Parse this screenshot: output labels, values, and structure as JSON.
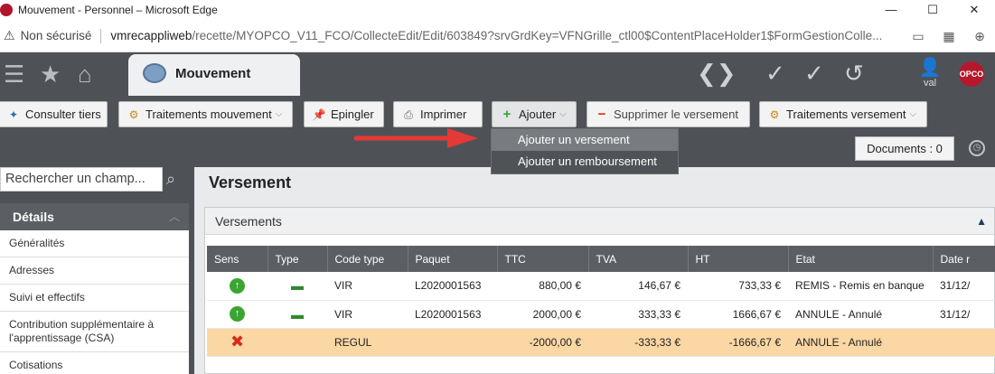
{
  "window": {
    "title": "Mouvement - Personnel – Microsoft Edge",
    "controls": {
      "minimize": "—",
      "maximize": "☐",
      "close": "✕"
    }
  },
  "addressbar": {
    "security_label": "Non sécurisé",
    "url_host": "vmrecappliweb",
    "url_path": "/recette/MYOPCO_V11_FCO/CollecteEdit/Edit/603849?srvGrdKey=VFNGrille_ctl00$ContentPlaceHolder1$FormGestionColle..."
  },
  "header": {
    "tab_label": "Mouvement",
    "user_name": "val",
    "logo_text": "OPCO"
  },
  "toolbar": {
    "buttons": [
      {
        "label": "Consulter tiers"
      },
      {
        "label": "Traitements mouvement"
      },
      {
        "label": "Epingler"
      },
      {
        "label": "Imprimer"
      },
      {
        "label": "Ajouter"
      },
      {
        "label": "Supprimer le versement"
      },
      {
        "label": "Traitements versement"
      }
    ],
    "documents_label": "Documents : 0"
  },
  "dropdown": {
    "items": [
      {
        "label": "Ajouter un versement"
      },
      {
        "label": "Ajouter un remboursement"
      }
    ]
  },
  "sidebar": {
    "search_placeholder": "Rechercher un champ...",
    "section_title": "Détails",
    "items": [
      {
        "label": "Généralités"
      },
      {
        "label": "Adresses"
      },
      {
        "label": "Suivi et effectifs"
      },
      {
        "label": "Contribution supplémentaire à l'apprentissage (CSA)"
      },
      {
        "label": "Cotisations"
      }
    ]
  },
  "main": {
    "title": "Versement",
    "panel_title": "Versements",
    "columns": [
      "Sens",
      "Type",
      "Code type",
      "Paquet",
      "TTC",
      "TVA",
      "HT",
      "Etat",
      "Date r"
    ],
    "rows": [
      {
        "sens": "up",
        "type": "money",
        "code": "VIR",
        "paquet": "L2020001563",
        "ttc": "880,00 €",
        "tva": "146,67 €",
        "ht": "733,33 €",
        "etat": "REMIS - Remis en banque",
        "date": "31/12/"
      },
      {
        "sens": "up",
        "type": "money",
        "code": "VIR",
        "paquet": "L2020001563",
        "ttc": "2000,00 €",
        "tva": "333,33 €",
        "ht": "1666,67 €",
        "etat": "ANNULE - Annulé",
        "date": "31/12/"
      },
      {
        "sens": "cross",
        "type": "",
        "code": "REGUL",
        "paquet": "",
        "ttc": "-2000,00 €",
        "tva": "-333,33 €",
        "ht": "-1666,67 €",
        "etat": "ANNULE - Annulé",
        "date": ""
      }
    ]
  },
  "colors": {
    "header_bg": "#4e5257",
    "regul_row": "#fbd7a3",
    "arrow": "#e53935"
  }
}
